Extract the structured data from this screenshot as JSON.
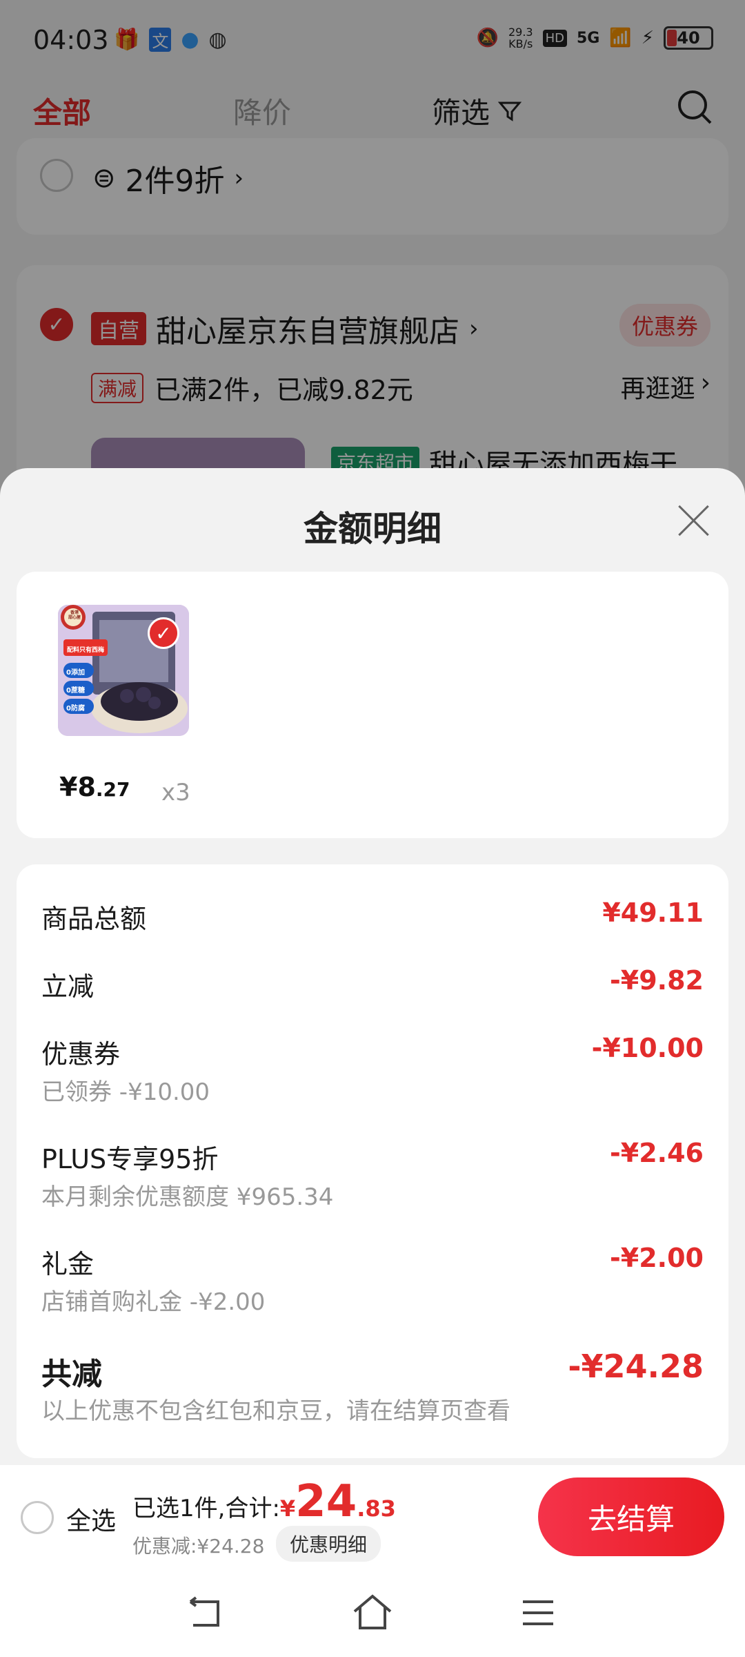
{
  "status_bar": {
    "time": "04:03",
    "net_speed_value": "29.3",
    "net_speed_unit": "KB/s",
    "hd": "HD",
    "signal": "5G",
    "battery": "40",
    "colors": {
      "battery_low": "#e23b3b"
    }
  },
  "tabs": {
    "all": "全部",
    "price_drop": "降价",
    "filter": "筛选"
  },
  "promo_row": {
    "text": "2件9折"
  },
  "store": {
    "self_run_tag": "自营",
    "name": "甜心屋京东自营旗舰店",
    "coupon": "优惠券",
    "promo_tag": "满减",
    "promo_text": "已满2件，已减9.82元",
    "more": "再逛逛",
    "market_tag": "京东超市",
    "product_title": "甜心屋无添加西梅干"
  },
  "sheet": {
    "title": "金额明细",
    "product": {
      "price_yuan": "¥8",
      "price_cents": ".27",
      "quantity": "x3",
      "image_text": {
        "badge_top": "香港",
        "badge_bottom": "甜心屋",
        "banner": "配料只有西梅",
        "labels": [
          "0添加",
          "0蔗糖",
          "0防腐"
        ]
      }
    },
    "rows": [
      {
        "label": "商品总额",
        "value": "¥49.11",
        "sub": ""
      },
      {
        "label": "立减",
        "value": "-¥9.82",
        "sub": ""
      },
      {
        "label": "优惠券",
        "value": "-¥10.00",
        "sub": "已领券 -¥10.00"
      },
      {
        "label": "PLUS专享95折",
        "value": "-¥2.46",
        "sub": "本月剩余优惠额度 ¥965.34"
      },
      {
        "label": "礼金",
        "value": "-¥2.00",
        "sub": "店铺首购礼金 -¥2.00"
      }
    ],
    "total": {
      "label": "共减",
      "value": "-¥24.28",
      "note": "以上优惠不包含红包和京豆，请在结算页查看"
    }
  },
  "bottom_bar": {
    "select_all": "全选",
    "selected_prefix": "已选1件,合计:",
    "currency": "¥",
    "total_int": "24",
    "total_dec": ".83",
    "discount": "优惠减:¥24.28",
    "detail_btn": "优惠明细",
    "checkout": "去结算",
    "colors": {
      "accent": "#e22c2c"
    }
  }
}
